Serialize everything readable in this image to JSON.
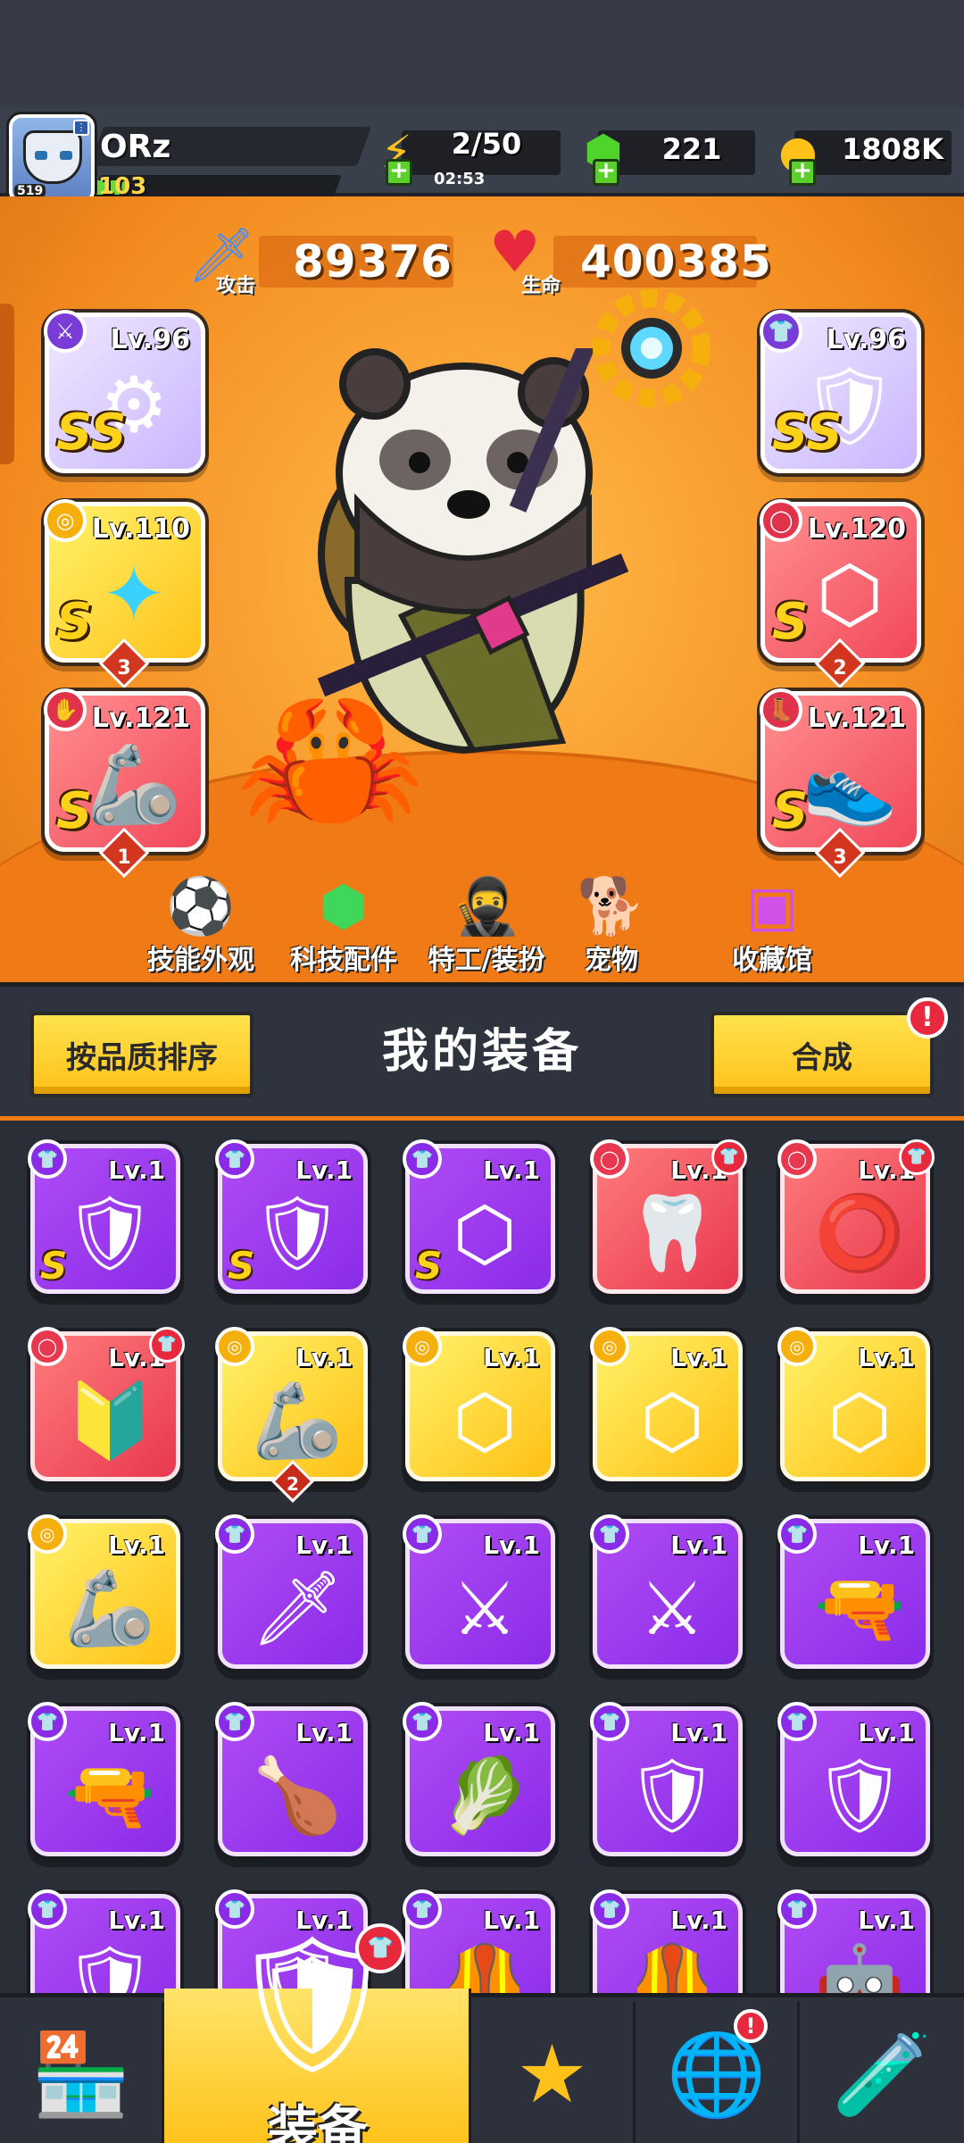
{
  "player": {
    "name": "ORz",
    "level": "103",
    "avatar_badge": "519",
    "avatar_icon": "wolf-avatar-icon"
  },
  "resources": {
    "energy": {
      "value": "2/50",
      "timer": "02:53",
      "icon": "lightning-icon"
    },
    "gems": {
      "value": "221",
      "icon": "gem-icon"
    },
    "coins": {
      "value": "1808K",
      "icon": "coin-icon"
    }
  },
  "stats": {
    "attack": {
      "label": "攻击",
      "value": "89376",
      "icon": "sword-icon"
    },
    "health": {
      "label": "生命",
      "value": "400385",
      "icon": "heart-icon"
    }
  },
  "equipped": [
    {
      "slot": "weapon",
      "level": "Lv.96",
      "rank": "SS",
      "quality": "purple",
      "icon": "gear-staff-icon"
    },
    {
      "slot": "armor",
      "level": "Lv.96",
      "rank": "SS",
      "quality": "purple",
      "icon": "chest-armor-icon"
    },
    {
      "slot": "necklace",
      "level": "Lv.110",
      "rank": "S",
      "quality": "yellow",
      "stars": "3",
      "icon": "necklace-icon"
    },
    {
      "slot": "belt",
      "level": "Lv.120",
      "rank": "S",
      "quality": "red",
      "stars": "2",
      "icon": "belt-icon"
    },
    {
      "slot": "gloves",
      "level": "Lv.121",
      "rank": "S",
      "quality": "red",
      "stars": "1",
      "icon": "gauntlet-icon"
    },
    {
      "slot": "boots",
      "level": "Lv.121",
      "rank": "S",
      "quality": "red",
      "stars": "3",
      "icon": "boots-icon"
    }
  ],
  "features": [
    {
      "label": "技能外观",
      "icon": "skill-skin-icon"
    },
    {
      "label": "科技配件",
      "icon": "tech-part-icon"
    },
    {
      "label": "特工/装扮",
      "icon": "agent-costume-icon"
    },
    {
      "label": "宠物",
      "icon": "pet-icon"
    },
    {
      "label": "收藏馆",
      "icon": "collection-chest-icon"
    }
  ],
  "gear_panel": {
    "title": "我的装备",
    "sort_button": "按品质排序",
    "merge_button": "合成",
    "alert": "!"
  },
  "inventory": [
    {
      "level": "Lv.1",
      "quality": "purple",
      "rank": "S",
      "icon": "armor-icon"
    },
    {
      "level": "Lv.1",
      "quality": "purple",
      "rank": "S",
      "icon": "armor-icon"
    },
    {
      "level": "Lv.1",
      "quality": "purple",
      "rank": "S",
      "icon": "belt-icon"
    },
    {
      "level": "Lv.1",
      "quality": "red",
      "rank": "",
      "icon": "fang-necklace-icon"
    },
    {
      "level": "Lv.1",
      "quality": "red",
      "rank": "",
      "icon": "spiked-collar-icon"
    },
    {
      "level": "Lv.1",
      "quality": "red",
      "rank": "",
      "icon": "badge-necklace-icon"
    },
    {
      "level": "Lv.1",
      "quality": "yellow",
      "rank": "",
      "stars": "2",
      "icon": "gauntlet-icon"
    },
    {
      "level": "Lv.1",
      "quality": "yellow",
      "rank": "",
      "icon": "belt-icon"
    },
    {
      "level": "Lv.1",
      "quality": "yellow",
      "rank": "",
      "icon": "belt-icon"
    },
    {
      "level": "Lv.1",
      "quality": "yellow",
      "rank": "",
      "icon": "belt-icon"
    },
    {
      "level": "Lv.1",
      "quality": "yellow",
      "rank": "",
      "icon": "gauntlet-icon"
    },
    {
      "level": "Lv.1",
      "quality": "purple",
      "rank": "",
      "icon": "kunai-icon"
    },
    {
      "level": "Lv.1",
      "quality": "purple",
      "rank": "",
      "icon": "katana-icon"
    },
    {
      "level": "Lv.1",
      "quality": "purple",
      "rank": "",
      "icon": "katana-icon"
    },
    {
      "level": "Lv.1",
      "quality": "purple",
      "rank": "",
      "icon": "revolver-icon"
    },
    {
      "level": "Lv.1",
      "quality": "purple",
      "rank": "",
      "icon": "shotgun-icon"
    },
    {
      "level": "Lv.1",
      "quality": "purple",
      "rank": "",
      "icon": "drumstick-icon"
    },
    {
      "level": "Lv.1",
      "quality": "purple",
      "rank": "",
      "icon": "leaf-armor-icon"
    },
    {
      "level": "Lv.1",
      "quality": "purple",
      "rank": "",
      "icon": "plate-armor-icon"
    },
    {
      "level": "Lv.1",
      "quality": "purple",
      "rank": "",
      "icon": "plate-armor-icon"
    },
    {
      "level": "Lv.1",
      "quality": "purple",
      "rank": "",
      "icon": "plate-armor-icon"
    },
    {
      "level": "Lv.1",
      "quality": "purple",
      "rank": "",
      "icon": "plate-armor-icon"
    },
    {
      "level": "Lv.1",
      "quality": "purple",
      "rank": "",
      "icon": "vest-armor-icon"
    },
    {
      "level": "Lv.1",
      "quality": "purple",
      "rank": "",
      "icon": "vest-armor-icon"
    },
    {
      "level": "Lv.1",
      "quality": "purple",
      "rank": "",
      "icon": "tech-armor-icon"
    }
  ],
  "bottom_nav": [
    {
      "label": "",
      "icon": "shop-icon"
    },
    {
      "label": "装备",
      "icon": "equipment-icon",
      "active": true
    },
    {
      "label": "",
      "icon": "battle-star-icon"
    },
    {
      "label": "",
      "icon": "planet-icon",
      "alert": "!"
    },
    {
      "label": "",
      "icon": "gene-capsule-icon"
    }
  ],
  "colors": {
    "orange_bg": "#f9a032",
    "purple": "#8a2be8",
    "yellow": "#ffc014",
    "red": "#e8384f",
    "panel": "#2a2e37"
  }
}
